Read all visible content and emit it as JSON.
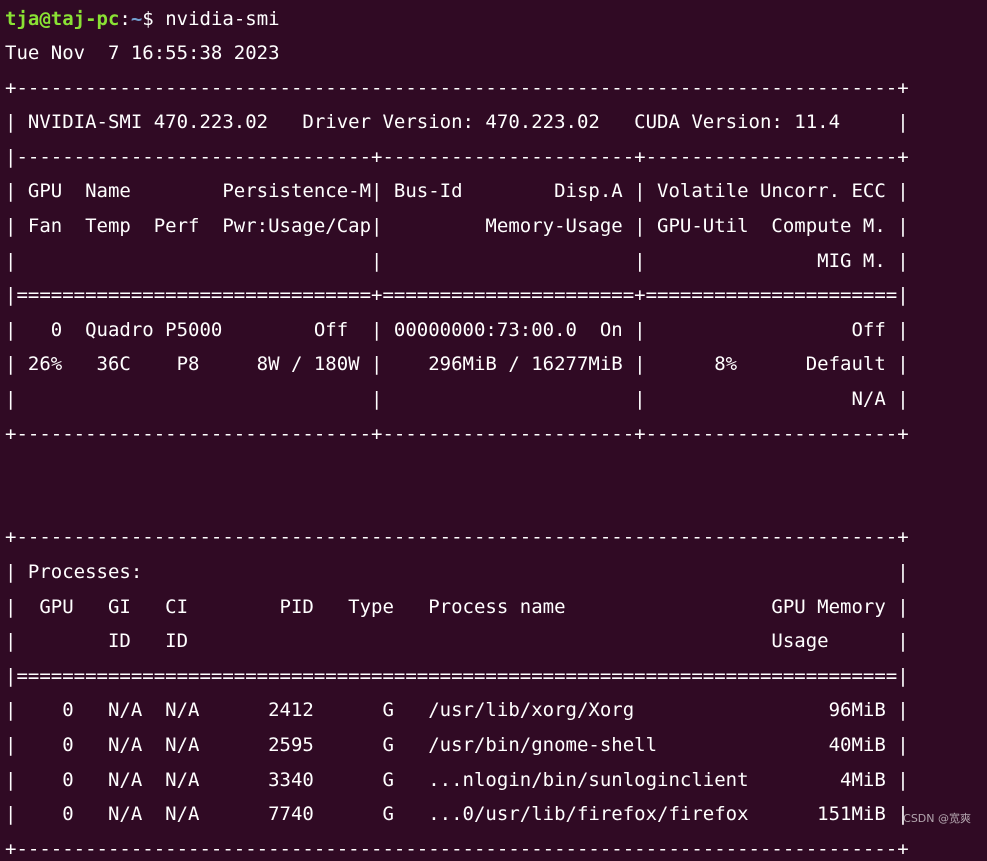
{
  "terminal": {
    "prompt": {
      "user_host": "tja@taj-pc",
      "separator": ":",
      "path": "~",
      "symbol": "$",
      "command": " nvidia-smi"
    },
    "lines": [
      "Tue Nov  7 16:55:38 2023",
      "+-----------------------------------------------------------------------------+",
      "| NVIDIA-SMI 470.223.02   Driver Version: 470.223.02   CUDA Version: 11.4     |",
      "|-------------------------------+----------------------+----------------------+",
      "| GPU  Name        Persistence-M| Bus-Id        Disp.A | Volatile Uncorr. ECC |",
      "| Fan  Temp  Perf  Pwr:Usage/Cap|         Memory-Usage | GPU-Util  Compute M. |",
      "|                               |                      |               MIG M. |",
      "|===============================+======================+======================|",
      "|   0  Quadro P5000        Off  | 00000000:73:00.0  On |                  Off |",
      "| 26%   36C    P8     8W / 180W |    296MiB / 16277MiB |      8%      Default |",
      "|                               |                      |                  N/A |",
      "+-------------------------------+----------------------+----------------------+",
      "",
      "",
      "+-----------------------------------------------------------------------------+",
      "| Processes:                                                                  |",
      "|  GPU   GI   CI        PID   Type   Process name                  GPU Memory |",
      "|        ID   ID                                                   Usage      |",
      "|=============================================================================|",
      "|    0   N/A  N/A      2412      G   /usr/lib/xorg/Xorg                 96MiB |",
      "|    0   N/A  N/A      2595      G   /usr/bin/gnome-shell               40MiB |",
      "|    0   N/A  N/A      3340      G   ...nlogin/bin/sunloginclient        4MiB |",
      "|    0   N/A  N/A      7740      G   ...0/usr/lib/firefox/firefox      151MiB |",
      "+-----------------------------------------------------------------------------+"
    ]
  },
  "watermark": "CSDN @宽爽",
  "colors": {
    "background": "#300a24",
    "text": "#ffffff",
    "prompt_user": "#8ae234",
    "prompt_path": "#729fcf"
  }
}
